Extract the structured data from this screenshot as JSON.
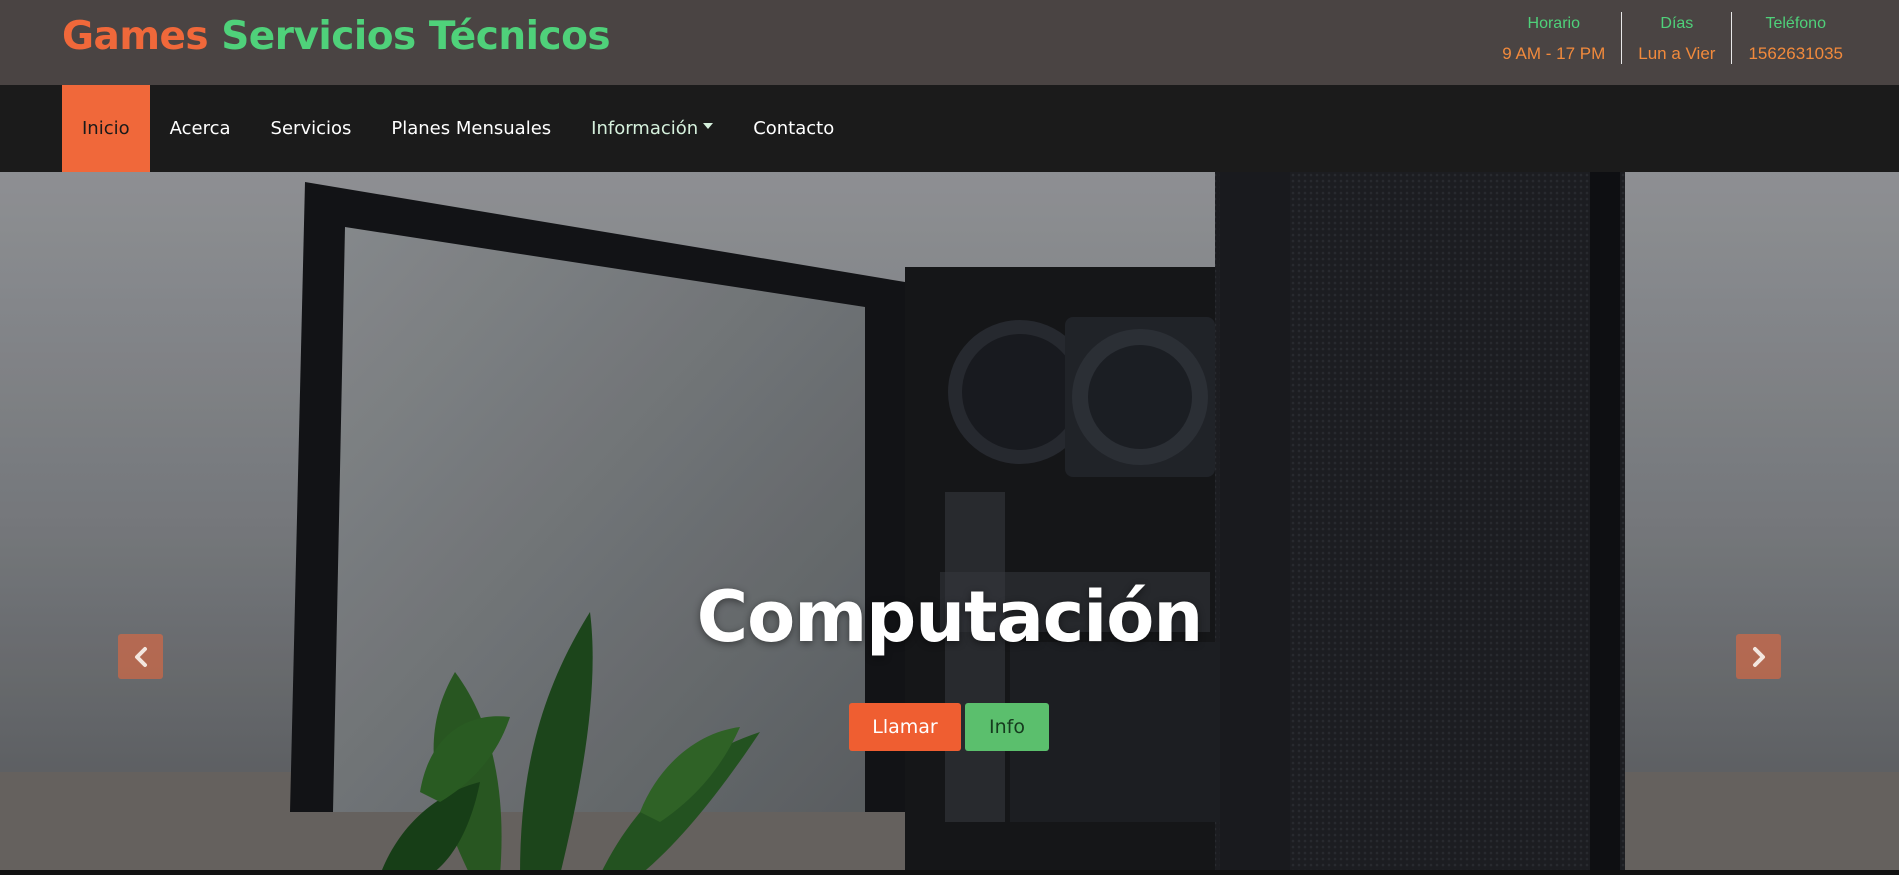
{
  "brand": {
    "part1": "Games",
    "part2": "Servicios Técnicos",
    "colors": {
      "part1": "#f0683a",
      "part2": "#4fd17a"
    }
  },
  "header_info": [
    {
      "label": "Horario",
      "value": "9 AM - 17 PM"
    },
    {
      "label": "Días",
      "value": "Lun a Vier"
    },
    {
      "label": "Teléfono",
      "value": "1562631035"
    }
  ],
  "nav": {
    "items": [
      {
        "label": "Inicio",
        "active": true
      },
      {
        "label": "Acerca"
      },
      {
        "label": "Servicios"
      },
      {
        "label": "Planes Mensuales"
      },
      {
        "label": "Información",
        "dropdown": true
      },
      {
        "label": "Contacto"
      }
    ]
  },
  "hero": {
    "title": "Computación",
    "call_button": "Llamar",
    "info_button": "Info",
    "prev_icon": "chevron-left-icon",
    "next_icon": "chevron-right-icon"
  },
  "colors": {
    "accent_orange": "#f0683a",
    "accent_green": "#4fd17a",
    "topbar_bg": "#4a4443",
    "navbar_bg": "#1b1b1b"
  }
}
